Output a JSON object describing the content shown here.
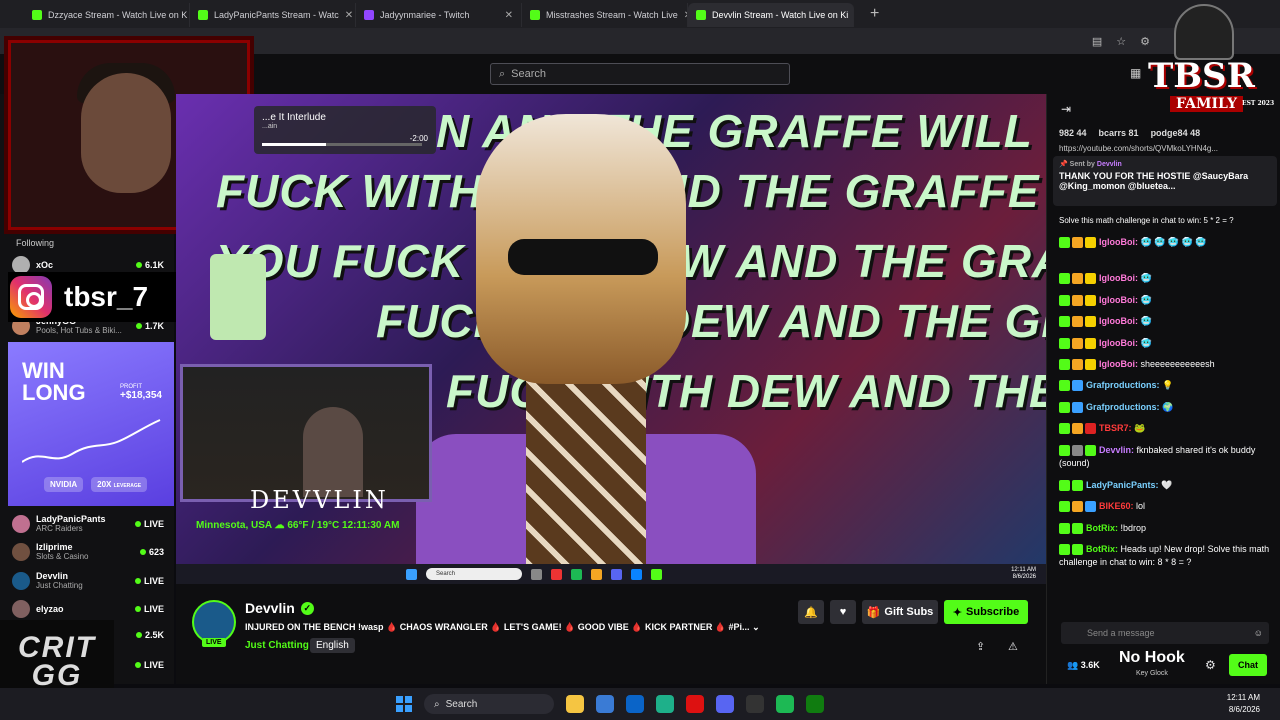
{
  "browser": {
    "tabs": [
      {
        "label": "Dzzyace Stream - Watch Live on K",
        "color": "#53fc18"
      },
      {
        "label": "LadyPanicPants Stream - Watc",
        "color": "#53fc18"
      },
      {
        "label": "Jadyynmariee - Twitch",
        "color": "#9146ff"
      },
      {
        "label": "Misstrashes Stream - Watch Live",
        "color": "#53fc18"
      },
      {
        "label": "Devvlin Stream - Watch Live on Ki",
        "color": "#53fc18"
      }
    ],
    "new_tab": "+"
  },
  "search": {
    "placeholder": "Search"
  },
  "sidebar": {
    "following_label": "Following",
    "items": [
      {
        "name": "xOc",
        "category": "",
        "viewers": "6.1K",
        "color": "#b0b0b0"
      },
      {
        "name": "JennyGG",
        "category": "Pools, Hot Tubs & Biki...",
        "viewers": "1.7K",
        "color": "#c08060"
      },
      {
        "name": "LadyPanicPants",
        "category": "ARC Raiders",
        "viewers": "LIVE",
        "color": "#c07090"
      },
      {
        "name": "Izliprime",
        "category": "Slots & Casino",
        "viewers": "623",
        "color": "#705040"
      },
      {
        "name": "Devvlin",
        "category": "Just Chatting",
        "viewers": "LIVE",
        "color": "#1a5a8a"
      },
      {
        "name": "elyzao",
        "category": "",
        "viewers": "LIVE",
        "color": "#806060"
      },
      {
        "name": "",
        "category": "",
        "viewers": "2.5K",
        "color": "#333"
      },
      {
        "name": "",
        "category": "",
        "viewers": "LIVE",
        "color": "#333"
      }
    ]
  },
  "overlay": {
    "instagram_handle": "tbsr_7",
    "ad": {
      "title_1": "WIN",
      "title_2": "LONG",
      "profit_label": "PROFIT",
      "profit": "+$18,354",
      "chip_1": "NVIDIA",
      "chip_2": "20X",
      "chip_2_sub": "LEVERAGE"
    },
    "critgg": "CRIT GG",
    "tbsr_big": "TBSR",
    "tbsr_family": "FAMILY",
    "tbsr_est": "EST 2023"
  },
  "player": {
    "graffiti_lines": [
      "N AND THE GRAFFE WILL FIND",
      "FUCK WITH DEW AND THE GRAFFE WILL FIND",
      "YOU FUCK WITH DEW AND THE GRAFFE WILL FI",
      "FUCK WITH DEW AND THE GRAFFE WIL",
      "FUCK WITH DEW AND THE GRAFFE"
    ],
    "music": {
      "title": "...e It Interlude",
      "artist": "...ain",
      "time_left": "-2:00",
      "progress": 0.4
    },
    "streamer_logo": "DEVVLIN",
    "location": "Minnesota, USA",
    "weather": "66°F / 19°C",
    "time": "12:11:30 AM",
    "inner_search": "Search",
    "inner_clock_time": "12:11 AM",
    "inner_clock_date": "8/6/2026"
  },
  "channel": {
    "name": "Devvlin",
    "live_badge": "LIVE",
    "title": "INJURED ON THE BENCH !wasp 🩸 CHAOS WRANGLER 🩸 LET'S GAME! 🩸 GOOD VIBE 🩸 KICK PARTNER 🩸 #Pi...",
    "category": "Just Chatting",
    "language": "English",
    "gift_label": "Gift Subs",
    "subscribe_label": "Subscribe"
  },
  "chat": {
    "top_count": "982 44",
    "top_user_1": "bcarrs 81",
    "top_user_2": "podge84 48",
    "link": "https://youtube.com/shorts/QVMkoLYHN4g...",
    "pinned": {
      "sent_by": "Sent by",
      "sender": "Devvlin",
      "text": "THANK YOU FOR THE HOSTIE @SaucyBara @King_momon @bluetea..."
    },
    "messages": [
      {
        "user": "",
        "text": "Solve this math challenge in chat to win: 5 * 2 = ?",
        "color": "#fff"
      },
      {
        "user": "IglooBoi:",
        "text": "🥶 🥶 🥶 🥶 🥶",
        "color": "#ff7ad9"
      },
      {
        "user": "IglooBoi:",
        "text": "🥶",
        "color": "#ff7ad9"
      },
      {
        "user": "IglooBoi:",
        "text": "🥶",
        "color": "#ff7ad9"
      },
      {
        "user": "IglooBoi:",
        "text": "🥶",
        "color": "#ff7ad9"
      },
      {
        "user": "IglooBoi:",
        "text": "🥶",
        "color": "#ff7ad9"
      },
      {
        "user": "IglooBoi:",
        "text": "sheeeeeeeeeeesh",
        "color": "#ff7ad9"
      },
      {
        "user": "Grafproductions:",
        "text": "💡",
        "color": "#7ad0ff"
      },
      {
        "user": "Grafproductions:",
        "text": "🌍",
        "color": "#7ad0ff"
      },
      {
        "user": "TBSR7:",
        "text": "🐸",
        "color": "#ff3b3b"
      },
      {
        "user": "Devvlin:",
        "text": "fknbaked shared it's ok buddy (sound)",
        "color": "#c77dff"
      },
      {
        "user": "LadyPanicPants:",
        "text": "🤍",
        "color": "#7ad0ff"
      },
      {
        "user": "BIKE60:",
        "text": "lol",
        "color": "#ff3b3b"
      },
      {
        "user": "BotRix:",
        "text": "!bdrop",
        "color": "#53fc18"
      },
      {
        "user": "BotRix:",
        "text": "Heads up! New drop! Solve this math challenge in chat to win: 8 * 8 = ?",
        "color": "#53fc18"
      }
    ],
    "input_placeholder": "Send a message",
    "viewers": "3.6K",
    "chat_button": "Chat",
    "nohook": "No Hook",
    "nohook_sub": "Key Glock"
  },
  "taskbar": {
    "search": "Search",
    "time": "12:11 AM",
    "date": "8/6/2026"
  }
}
